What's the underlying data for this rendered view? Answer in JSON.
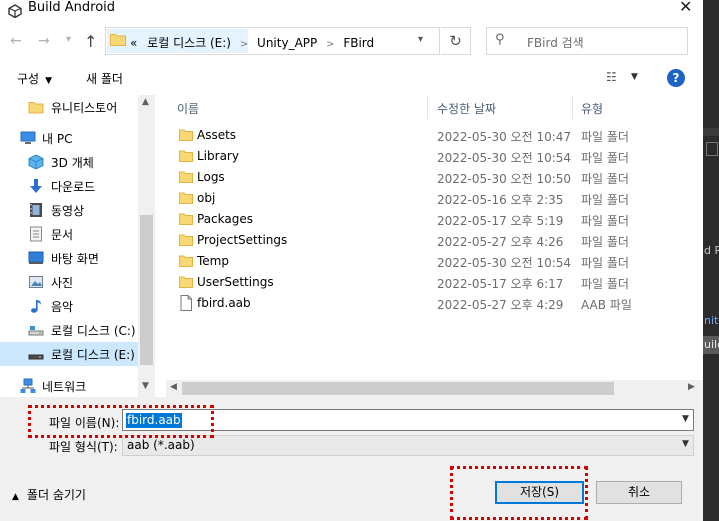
{
  "window": {
    "title": "Build Android",
    "close_glyph": "✕"
  },
  "address": {
    "recent_glyph": "«",
    "crumbs": [
      "로컬 디스크 (E:)",
      "Unity_APP",
      "FBird"
    ]
  },
  "search": {
    "placeholder": "FBird 검색"
  },
  "toolbar": {
    "organize_label": "구성",
    "new_folder_label": "새 폴더",
    "help_glyph": "?"
  },
  "nav": {
    "items": [
      {
        "label": "유니티스토어",
        "icon": "folder-icon"
      },
      {
        "label": "내 PC",
        "icon": "pc-icon"
      },
      {
        "label": "3D 개체",
        "icon": "cube-icon"
      },
      {
        "label": "다운로드",
        "icon": "download-icon"
      },
      {
        "label": "동영상",
        "icon": "video-icon"
      },
      {
        "label": "문서",
        "icon": "document-icon"
      },
      {
        "label": "바탕 화면",
        "icon": "desktop-icon"
      },
      {
        "label": "사진",
        "icon": "picture-icon"
      },
      {
        "label": "음악",
        "icon": "music-icon"
      },
      {
        "label": "로컬 디스크 (C:)",
        "icon": "drive-icon"
      },
      {
        "label": "로컬 디스크 (E:)",
        "icon": "drive-icon"
      },
      {
        "label": "네트워크",
        "icon": "network-icon"
      }
    ]
  },
  "columns": {
    "name": "이름",
    "date": "수정한 날짜",
    "type": "유형"
  },
  "files": [
    {
      "name": "Assets",
      "date": "2022-05-30 오전 10:47",
      "type": "파일 폴더",
      "kind": "folder"
    },
    {
      "name": "Library",
      "date": "2022-05-30 오전 10:54",
      "type": "파일 폴더",
      "kind": "folder"
    },
    {
      "name": "Logs",
      "date": "2022-05-30 오전 10:50",
      "type": "파일 폴더",
      "kind": "folder"
    },
    {
      "name": "obj",
      "date": "2022-05-16 오후 2:35",
      "type": "파일 폴더",
      "kind": "folder"
    },
    {
      "name": "Packages",
      "date": "2022-05-17 오후 5:19",
      "type": "파일 폴더",
      "kind": "folder"
    },
    {
      "name": "ProjectSettings",
      "date": "2022-05-27 오후 4:26",
      "type": "파일 폴더",
      "kind": "folder"
    },
    {
      "name": "Temp",
      "date": "2022-05-30 오전 10:54",
      "type": "파일 폴더",
      "kind": "folder"
    },
    {
      "name": "UserSettings",
      "date": "2022-05-17 오후 6:17",
      "type": "파일 폴더",
      "kind": "folder"
    },
    {
      "name": "fbird.aab",
      "date": "2022-05-27 오후 4:29",
      "type": "AAB 파일",
      "kind": "file"
    }
  ],
  "form": {
    "filename_label": "파일 이름(N):",
    "filename_value": "fbird.aab",
    "filetype_label": "파일 형식(T):",
    "filetype_value": "aab (*.aab)"
  },
  "footer": {
    "hide_folders_label": "폴더 숨기기",
    "save_label": "저장(S)",
    "cancel_label": "취소"
  },
  "background_window": {
    "fragments": [
      "d Ru",
      "nity",
      "uild"
    ]
  },
  "colors": {
    "selection": "#0078d7",
    "nav_selected": "#cce8ff",
    "folder": "#f8d775",
    "highlight_box": "#d60000"
  }
}
